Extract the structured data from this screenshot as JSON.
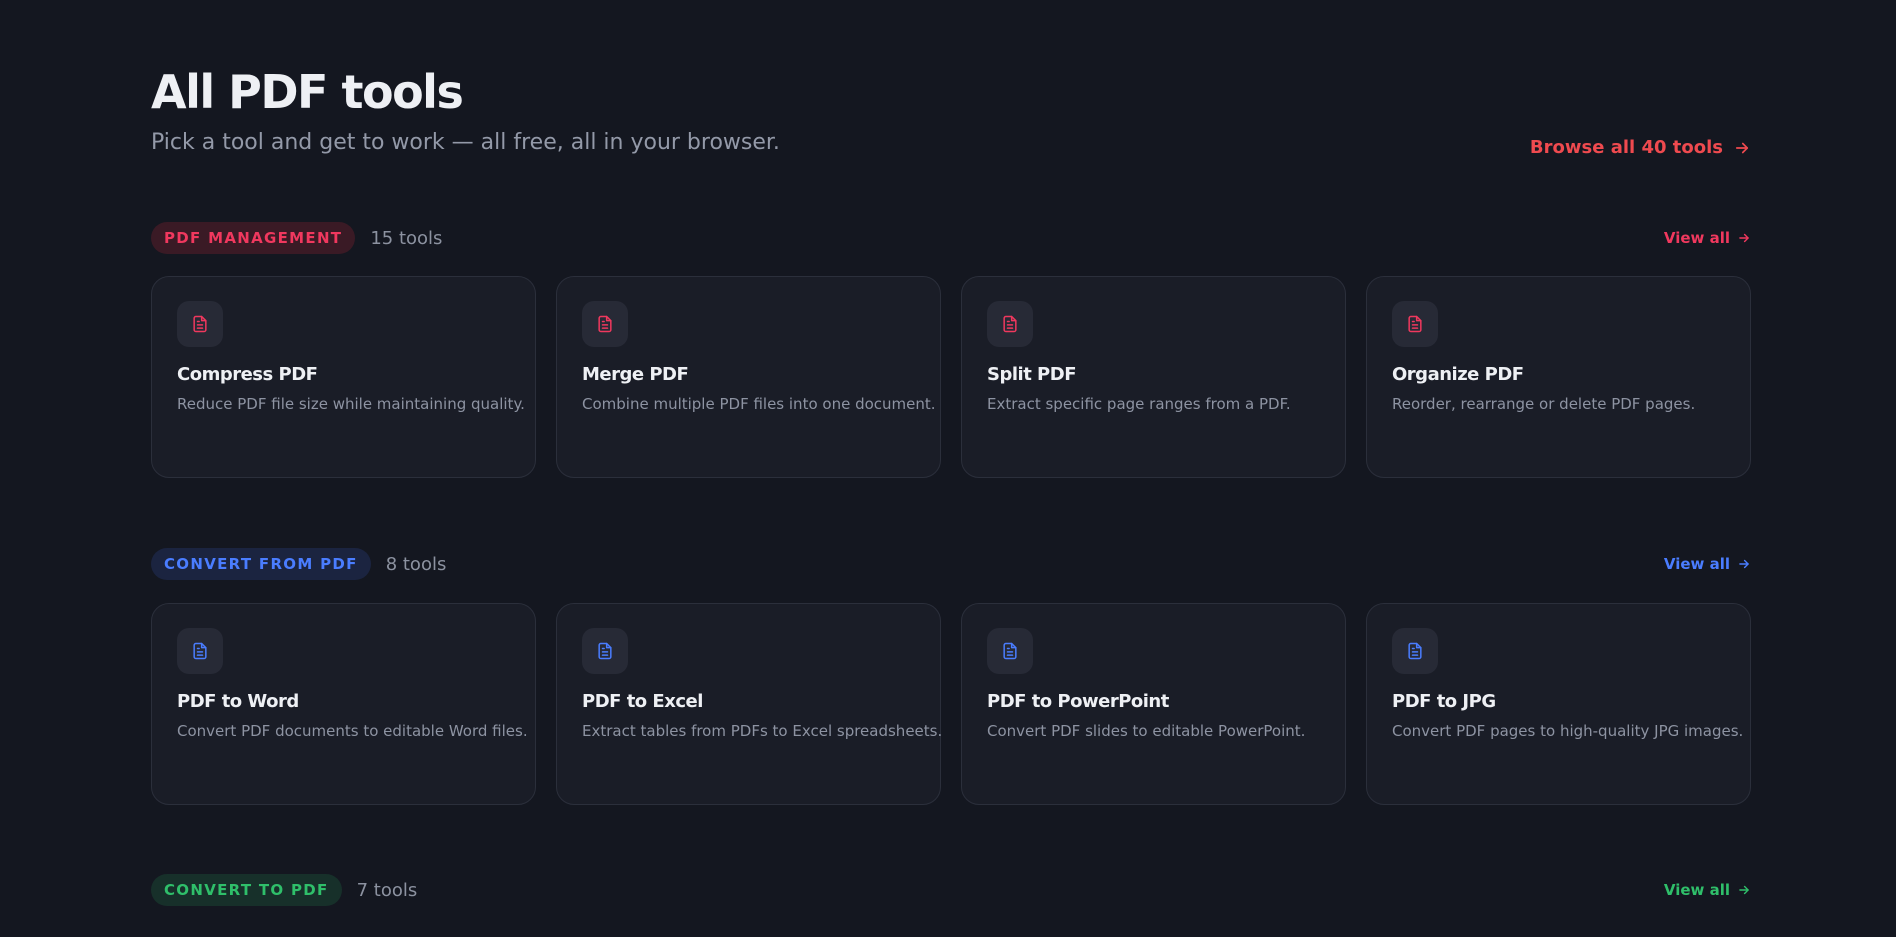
{
  "header": {
    "title": "All PDF tools",
    "subtitle": "Pick a tool and get to work — all free, all in your browser.",
    "browse_all_label": "Browse all 40 tools",
    "accent_color": "#ef4a4f"
  },
  "sections": [
    {
      "badge": "PDF MANAGEMENT",
      "count": "15 tools",
      "view_all": "View all",
      "color": "#f0385e",
      "badge_bg": "#3a1a25",
      "tools": [
        {
          "title": "Compress PDF",
          "desc": "Reduce PDF file size while maintaining quality.",
          "icon": "document-icon"
        },
        {
          "title": "Merge PDF",
          "desc": "Combine multiple PDF files into one document.",
          "icon": "document-icon"
        },
        {
          "title": "Split PDF",
          "desc": "Extract specific page ranges from a PDF.",
          "icon": "document-icon"
        },
        {
          "title": "Organize PDF",
          "desc": "Reorder, rearrange or delete PDF pages.",
          "icon": "document-icon"
        }
      ]
    },
    {
      "badge": "CONVERT FROM PDF",
      "count": "8 tools",
      "view_all": "View all",
      "color": "#4a7dff",
      "badge_bg": "#1b2440",
      "tools": [
        {
          "title": "PDF to Word",
          "desc": "Convert PDF documents to editable Word files.",
          "icon": "document-icon"
        },
        {
          "title": "PDF to Excel",
          "desc": "Extract tables from PDFs to Excel spreadsheets.",
          "icon": "document-icon"
        },
        {
          "title": "PDF to PowerPoint",
          "desc": "Convert PDF slides to editable PowerPoint.",
          "icon": "document-icon"
        },
        {
          "title": "PDF to JPG",
          "desc": "Convert PDF pages to high-quality JPG images.",
          "icon": "document-icon"
        }
      ]
    },
    {
      "badge": "CONVERT TO PDF",
      "count": "7 tools",
      "view_all": "View all",
      "color": "#2fbf6a",
      "badge_bg": "#17302a",
      "tools": []
    }
  ]
}
